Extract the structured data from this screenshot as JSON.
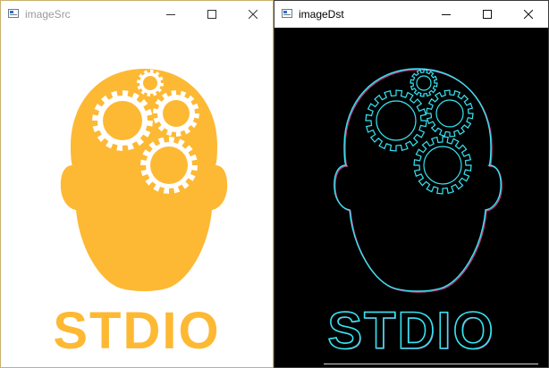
{
  "windows": [
    {
      "title": "imageSrc",
      "icon": "app-window-icon",
      "wordmark": "STDIO",
      "colors": {
        "logo": "#FDB933",
        "background": "#FFFFFF"
      }
    },
    {
      "title": "imageDst",
      "icon": "app-window-icon",
      "wordmark": "STDIO",
      "colors": {
        "edges": "#36E4F2",
        "edge_fringe": "#C33F86",
        "background": "#000000"
      }
    }
  ],
  "controls": [
    "minimize-icon",
    "maximize-icon",
    "close-icon"
  ]
}
